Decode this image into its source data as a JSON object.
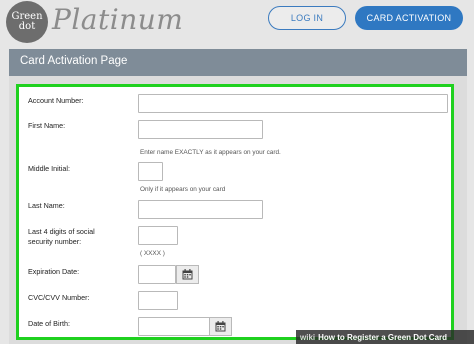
{
  "header": {
    "logo_line1": "Green",
    "logo_line2": "dot",
    "logo_word": "Platinum",
    "login_label": "LOG IN",
    "activation_label": "CARD ACTIVATION"
  },
  "panel": {
    "title": "Card Activation Page"
  },
  "form": {
    "account_number_label": "Account Number:",
    "first_name_label": "First Name:",
    "first_name_hint": "Enter name EXACTLY as it appears on your card.",
    "middle_initial_label": "Middle Initial:",
    "middle_initial_hint": "Only if it appears on your card",
    "last_name_label": "Last Name:",
    "ssn_label_line1": "Last 4 digits of social",
    "ssn_label_line2": "security number:",
    "ssn_hint": "( XXXX )",
    "expiration_label": "Expiration Date:",
    "cvc_label": "CVC/CVV Number:",
    "dob_label": "Date of Birth:"
  },
  "watermark": {
    "prefix": "wiki",
    "text": "How to Register a Green Dot Card"
  },
  "colors": {
    "accent_blue": "#2f78c2",
    "highlight_green": "#1fd11f",
    "panel_header": "#7f8c98"
  },
  "icons": [
    "calendar-icon"
  ]
}
